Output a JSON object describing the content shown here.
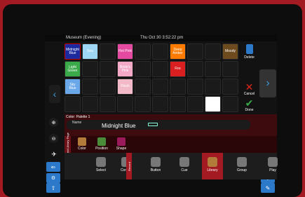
{
  "statusbar": {
    "venue": "Museum (Evening)",
    "time": "Thu Oct 30 3:52:22 pm"
  },
  "grid_cells": [
    {
      "label": "Midnight Blue",
      "bg": "#1c2aa0",
      "selected": true
    },
    {
      "label": "Sea",
      "bg": "#9fd6f3"
    },
    {
      "label": ""
    },
    {
      "label": "Hot Pink",
      "bg": "#e44aa0"
    },
    {
      "label": ""
    },
    {
      "label": ""
    },
    {
      "label": "Deep Amber",
      "bg": "#ff7b00"
    },
    {
      "label": ""
    },
    {
      "label": ""
    },
    {
      "label": "Moody",
      "bg": "#6d4b1f"
    },
    {
      "label": "Light Green",
      "bg": "#3aa94a"
    },
    {
      "label": ""
    },
    {
      "label": ""
    },
    {
      "label": "Bride's Pink",
      "bg": "#f4a9c6"
    },
    {
      "label": ""
    },
    {
      "label": ""
    },
    {
      "label": "Fire",
      "bg": "#d91f1f"
    },
    {
      "label": ""
    },
    {
      "label": ""
    },
    {
      "label": ""
    },
    {
      "label": "Sky Blue",
      "bg": "#6aa7e8"
    },
    {
      "label": ""
    },
    {
      "label": ""
    },
    {
      "label": "Flesh",
      "bg": "#f2b9c8"
    },
    {
      "label": ""
    },
    {
      "label": ""
    },
    {
      "label": ""
    },
    {
      "label": ""
    },
    {
      "label": ""
    },
    {
      "label": ""
    },
    {
      "label": ""
    },
    {
      "label": ""
    },
    {
      "label": ""
    },
    {
      "label": ""
    },
    {
      "label": ""
    },
    {
      "label": ""
    },
    {
      "label": ""
    },
    {
      "label": ""
    },
    {
      "label": "",
      "bg": "#ffffff"
    },
    {
      "label": ""
    }
  ],
  "actions": {
    "delete": "Delete",
    "cancel": "Cancel",
    "done": "Done",
    "count": "10"
  },
  "palette": {
    "label": "Color: Palette 1",
    "name_label": "Name",
    "name_value": "Midnight Blue"
  },
  "library": {
    "vertical": "Select Library Page",
    "tabs": [
      {
        "label": "Color",
        "bg": "#b27b3a"
      },
      {
        "label": "Position",
        "bg": "#4a8b3a"
      },
      {
        "label": "Shape",
        "bg": "#9b1a5c"
      }
    ]
  },
  "toolbar": {
    "record": "Record",
    "items": [
      {
        "label": "Select",
        "icon": "select-icon"
      },
      {
        "label": "Control",
        "icon": "control-icon"
      },
      {
        "label": "Button",
        "icon": "button-icon"
      },
      {
        "label": "Cue",
        "icon": "cue-icon"
      },
      {
        "label": "Library",
        "icon": "library-icon",
        "active": true
      },
      {
        "label": "Group",
        "icon": "group-icon"
      },
      {
        "label": "Play",
        "icon": "play-icon"
      }
    ]
  }
}
